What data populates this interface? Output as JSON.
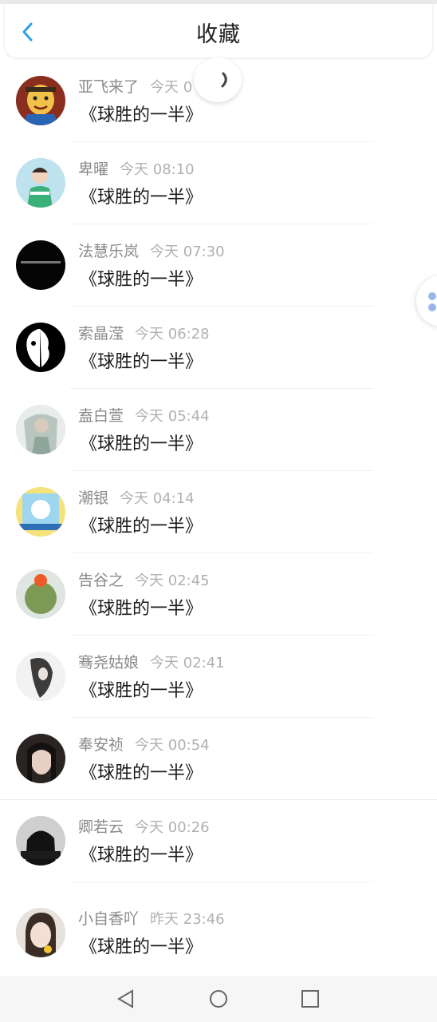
{
  "header": {
    "title": "收藏",
    "back_icon": "chevron-left-icon"
  },
  "items": [
    {
      "name": "亚飞来了",
      "time": "今天 0",
      "message": "《球胜的一半》"
    },
    {
      "name": "卑曜",
      "time": "今天 08:10",
      "message": "《球胜的一半》"
    },
    {
      "name": "法慧乐岚",
      "time": "今天 07:30",
      "message": "《球胜的一半》"
    },
    {
      "name": "索晶滢",
      "time": "今天 06:28",
      "message": "《球胜的一半》"
    },
    {
      "name": "盍白萱",
      "time": "今天 05:44",
      "message": "《球胜的一半》"
    },
    {
      "name": "潮银",
      "time": "今天 04:14",
      "message": "《球胜的一半》"
    },
    {
      "name": "告谷之",
      "time": "今天 02:45",
      "message": "《球胜的一半》"
    },
    {
      "name": "骞尧姑娘",
      "time": "今天 02:41",
      "message": "《球胜的一半》"
    },
    {
      "name": "奉安祯",
      "time": "今天 00:54",
      "message": "《球胜的一半》"
    },
    {
      "name": "卿若云",
      "time": "今天 00:26",
      "message": "《球胜的一半》"
    },
    {
      "name": "小自香吖",
      "time": "昨天 23:46",
      "message": "《球胜的一半》"
    }
  ],
  "navbar": {
    "back": "triangle-back-icon",
    "home": "circle-home-icon",
    "recent": "square-recent-icon"
  },
  "colors": {
    "accent": "#2f9fe8",
    "name": "#8a8a8a",
    "time": "#b0b0b0"
  }
}
